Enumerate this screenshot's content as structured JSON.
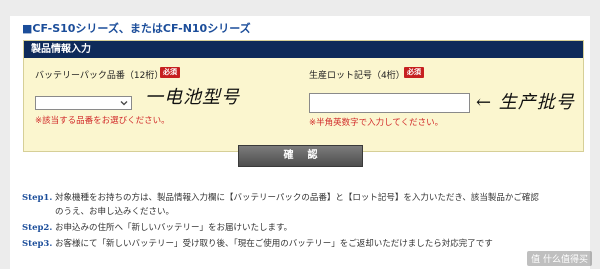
{
  "series_title": "■CF-S10シリーズ、またはCF-N10シリーズ",
  "panel": {
    "header": "製品情報入力",
    "battery": {
      "label": "バッテリーパック品番（12桁）",
      "required": "必須",
      "selected": "",
      "hint": "※該当する品番をお選びください。",
      "annotation": "一电池型号"
    },
    "lot": {
      "label": "生産ロット記号（4桁）",
      "required": "必須",
      "value": "",
      "hint": "※半角英数字で入力してください。",
      "annotation": "← 生产批号"
    }
  },
  "confirm_label": "確認",
  "steps": [
    {
      "label": "Step1.",
      "text": "対象機種をお持ちの方は、製品情報入力欄に【バッテリーパックの品番】と【ロット記号】を入力いただき、該当製品かご確認"
    },
    {
      "label": "",
      "text": "のうえ、お申し込みください。"
    },
    {
      "label": "Step2.",
      "text": "お申込みの住所へ「新しいバッテリー」をお届けいたします。"
    },
    {
      "label": "Step3.",
      "text": "お客様にて「新しいバッテリー」受け取り後、「現在ご使用のバッテリー」をご返却いただけましたら対応完了です"
    }
  ],
  "watermark": "值 什么值得买",
  "colors": {
    "panel_bg": "#fbf6cf",
    "header_bg": "#0e2a5a",
    "required_red": "#c62020",
    "hint_red": "#d12a2a",
    "step_blue": "#1b4d9a"
  }
}
